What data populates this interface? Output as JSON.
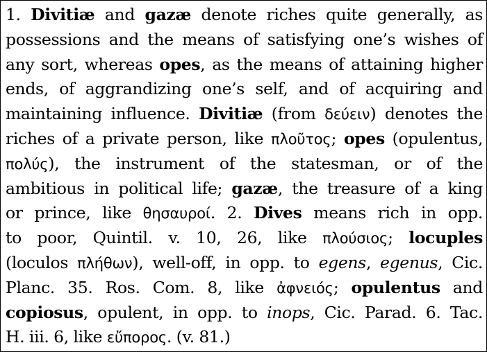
{
  "entry": {
    "line_01": [
      {
        "t": "1. ",
        "s": "r"
      },
      {
        "t": "Divitiæ",
        "s": "b"
      },
      {
        "t": " and ",
        "s": "r"
      },
      {
        "t": "gazæ",
        "s": "b"
      },
      {
        "t": " denote riches quite generally, as",
        "s": "r"
      }
    ],
    "line_02": [
      {
        "t": "possessions and the means of satisfying one’s wishes of",
        "s": "r"
      }
    ],
    "line_03": [
      {
        "t": "any sort, whereas ",
        "s": "r"
      },
      {
        "t": "opes",
        "s": "b"
      },
      {
        "t": ", as the means of attaining higher",
        "s": "r"
      }
    ],
    "line_04": [
      {
        "t": "ends, of aggrandizing one’s self, and of acquiring and",
        "s": "r"
      }
    ],
    "line_05": [
      {
        "t": "maintaining influence. ",
        "s": "r"
      },
      {
        "t": "Divitiæ",
        "s": "b"
      },
      {
        "t": " (from ",
        "s": "r"
      },
      {
        "t": "δεύειν",
        "s": "g"
      },
      {
        "t": ") denotes the",
        "s": "r"
      }
    ],
    "line_06": [
      {
        "t": "riches of a private person, like ",
        "s": "r"
      },
      {
        "t": "πλοῦτος",
        "s": "g"
      },
      {
        "t": "; ",
        "s": "r"
      },
      {
        "t": "opes",
        "s": "b"
      },
      {
        "t": " (opulentus,",
        "s": "r"
      }
    ],
    "line_07": [
      {
        "t": "πολύς",
        "s": "g"
      },
      {
        "t": "), the instrument of the statesman, or of the",
        "s": "r"
      }
    ],
    "line_08": [
      {
        "t": "ambitious in political life; ",
        "s": "r"
      },
      {
        "t": "gazæ",
        "s": "b"
      },
      {
        "t": ", the treasure of a king",
        "s": "r"
      }
    ],
    "line_09": [
      {
        "t": "or prince, like ",
        "s": "r"
      },
      {
        "t": "θησαυροί",
        "s": "g"
      },
      {
        "t": ". 2. ",
        "s": "r"
      },
      {
        "t": "Dives",
        "s": "b"
      },
      {
        "t": " means rich in opp.",
        "s": "r"
      }
    ],
    "line_10": [
      {
        "t": "to poor, Quintil. v. 10, 26, like ",
        "s": "r"
      },
      {
        "t": "πλούσιος",
        "s": "g"
      },
      {
        "t": "; ",
        "s": "r"
      },
      {
        "t": "locuples",
        "s": "b"
      }
    ],
    "line_11": [
      {
        "t": "(loculos ",
        "s": "r"
      },
      {
        "t": "πλήθων",
        "s": "g"
      },
      {
        "t": "), well-off, in opp. to ",
        "s": "r"
      },
      {
        "t": "egens",
        "s": "i"
      },
      {
        "t": ", ",
        "s": "r"
      },
      {
        "t": "egenus",
        "s": "i"
      },
      {
        "t": ", Cic.",
        "s": "r"
      }
    ],
    "line_12": [
      {
        "t": "Planc. 35. Ros. Com. 8, like ",
        "s": "r"
      },
      {
        "t": "ἀφνειός",
        "s": "g"
      },
      {
        "t": "; ",
        "s": "r"
      },
      {
        "t": "opulentus",
        "s": "b"
      },
      {
        "t": " and",
        "s": "r"
      }
    ],
    "line_13": [
      {
        "t": "copiosus",
        "s": "b"
      },
      {
        "t": ", opulent, in opp. to ",
        "s": "r"
      },
      {
        "t": "inops",
        "s": "i"
      },
      {
        "t": ", Cic. Parad. 6. Tac.",
        "s": "r"
      }
    ],
    "line_14": [
      {
        "t": "H. iii. 6, like ",
        "s": "r"
      },
      {
        "t": "εὔπορος",
        "s": "g"
      },
      {
        "t": ". (v. 81.)",
        "s": "r"
      }
    ]
  }
}
